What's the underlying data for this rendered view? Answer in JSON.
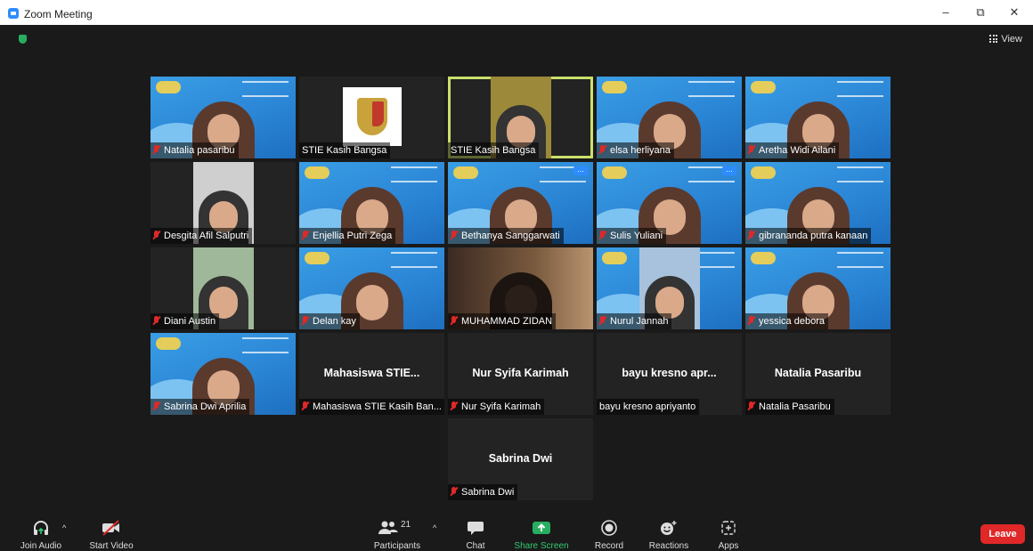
{
  "window": {
    "title": "Zoom Meeting",
    "minimize": "–",
    "restore": "⧉",
    "close": "✕"
  },
  "header": {
    "view_label": "View"
  },
  "tiles": [
    {
      "name": "Natalia pasaribu",
      "muted": true,
      "kind": "blue"
    },
    {
      "name": "STIE Kasih Bangsa",
      "muted": false,
      "kind": "crest"
    },
    {
      "name": "STIE Kasih Bangsa",
      "muted": false,
      "kind": "mustard",
      "active": true
    },
    {
      "name": "elsa herliyana",
      "muted": true,
      "kind": "blue"
    },
    {
      "name": "Aretha Widi Ailani",
      "muted": true,
      "kind": "blue"
    },
    {
      "name": "Desgita Afil Salputri",
      "muted": true,
      "kind": "box"
    },
    {
      "name": "Enjellia Putri Zega",
      "muted": true,
      "kind": "blue"
    },
    {
      "name": "Bethanya Sanggarwati",
      "muted": true,
      "kind": "blue",
      "more": true
    },
    {
      "name": "Sulis Yuliani",
      "muted": true,
      "kind": "blue",
      "more": true
    },
    {
      "name": "gibrananda putra kanaan",
      "muted": true,
      "kind": "blue"
    },
    {
      "name": "Diani Austin",
      "muted": true,
      "kind": "green"
    },
    {
      "name": "Delan kay",
      "muted": true,
      "kind": "blue"
    },
    {
      "name": "MUHAMMAD ZIDAN",
      "muted": true,
      "kind": "dark"
    },
    {
      "name": "Nurul Jannah",
      "muted": true,
      "kind": "blue-box"
    },
    {
      "name": "yessica debora",
      "muted": true,
      "kind": "blue"
    },
    {
      "name": "Sabrina Dwi Aprilia",
      "muted": true,
      "kind": "blue"
    },
    {
      "name": "Mahasiswa STIE Kasih Ban...",
      "muted": true,
      "kind": "noVideo",
      "display": "Mahasiswa  STIE..."
    },
    {
      "name": "Nur Syifa Karimah",
      "muted": true,
      "kind": "noVideo",
      "display": "Nur Syifa Karimah"
    },
    {
      "name": "bayu kresno apriyanto",
      "muted": false,
      "kind": "noVideo",
      "display": "bayu  kresno  apr..."
    },
    {
      "name": "Natalia Pasaribu",
      "muted": true,
      "kind": "noVideo",
      "display": "Natalia Pasaribu"
    },
    {
      "name": "Sabrina Dwi",
      "muted": true,
      "kind": "noVideo",
      "display": "Sabrina Dwi"
    }
  ],
  "toolbar": {
    "join_audio": "Join Audio",
    "start_video": "Start Video",
    "participants": "Participants",
    "participants_count": "21",
    "chat": "Chat",
    "share_screen": "Share Screen",
    "record": "Record",
    "reactions": "Reactions",
    "apps": "Apps",
    "leave": "Leave"
  },
  "colors": {
    "accent": "#2D8CFF",
    "share": "#27ae60",
    "leave": "#e02828",
    "active_speaker": "#c9e06b"
  }
}
